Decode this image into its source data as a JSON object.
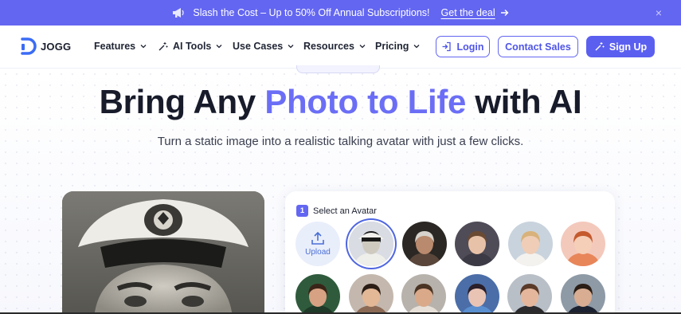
{
  "promo": {
    "text": "Slash the Cost – Up to 50% Off Annual Subscriptions!",
    "link": "Get the deal",
    "close": "×"
  },
  "logo": {
    "text": "JOGG"
  },
  "nav": {
    "items": [
      {
        "label": "Features"
      },
      {
        "label": "AI Tools"
      },
      {
        "label": "Use Cases"
      },
      {
        "label": "Resources"
      },
      {
        "label": "Pricing"
      }
    ],
    "login": "Login",
    "contact": "Contact Sales",
    "signup": "Sign Up"
  },
  "hero": {
    "title_part1": "Bring Any ",
    "title_accent": "Photo to Life",
    "title_part2": " with AI",
    "subtitle": "Turn a static image into a realistic talking avatar with just a few clicks."
  },
  "panel": {
    "step_number": "1",
    "step_label": "Select an Avatar",
    "upload_label": "Upload",
    "avatars": [
      {
        "name": "vintage-sailor",
        "selected": true
      },
      {
        "name": "elderly-woman",
        "selected": false
      },
      {
        "name": "woman-long-hair",
        "selected": false
      },
      {
        "name": "blonde-woman",
        "selected": false
      },
      {
        "name": "cartoon-girl",
        "selected": false
      },
      {
        "name": "smiling-woman",
        "selected": false
      },
      {
        "name": "dark-hair-woman",
        "selected": false
      },
      {
        "name": "young-man",
        "selected": false
      },
      {
        "name": "woman-neon",
        "selected": false
      },
      {
        "name": "brunette-woman",
        "selected": false
      },
      {
        "name": "man-suit",
        "selected": false
      }
    ]
  },
  "colors": {
    "brand": "#6366f1",
    "accent_text": "#6b6ef5",
    "dark_text": "#171b2a"
  }
}
